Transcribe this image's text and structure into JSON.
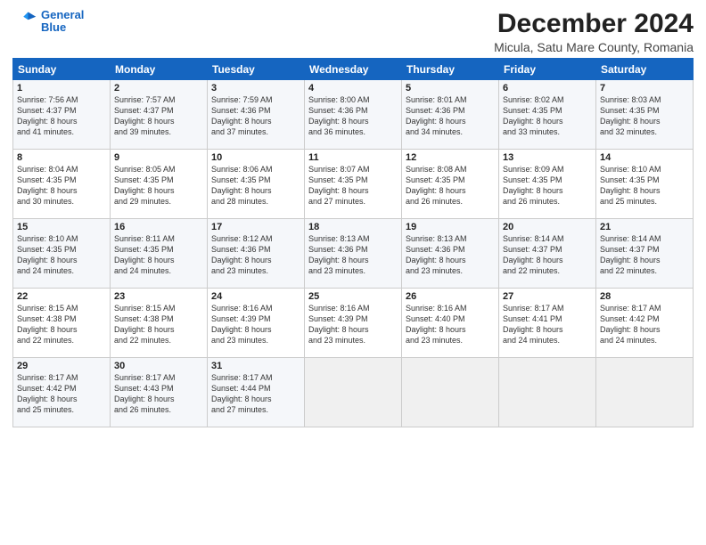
{
  "header": {
    "logo_line1": "General",
    "logo_line2": "Blue",
    "month_title": "December 2024",
    "location": "Micula, Satu Mare County, Romania"
  },
  "days_of_week": [
    "Sunday",
    "Monday",
    "Tuesday",
    "Wednesday",
    "Thursday",
    "Friday",
    "Saturday"
  ],
  "weeks": [
    [
      {
        "day": "1",
        "text": "Sunrise: 7:56 AM\nSunset: 4:37 PM\nDaylight: 8 hours\nand 41 minutes."
      },
      {
        "day": "2",
        "text": "Sunrise: 7:57 AM\nSunset: 4:37 PM\nDaylight: 8 hours\nand 39 minutes."
      },
      {
        "day": "3",
        "text": "Sunrise: 7:59 AM\nSunset: 4:36 PM\nDaylight: 8 hours\nand 37 minutes."
      },
      {
        "day": "4",
        "text": "Sunrise: 8:00 AM\nSunset: 4:36 PM\nDaylight: 8 hours\nand 36 minutes."
      },
      {
        "day": "5",
        "text": "Sunrise: 8:01 AM\nSunset: 4:36 PM\nDaylight: 8 hours\nand 34 minutes."
      },
      {
        "day": "6",
        "text": "Sunrise: 8:02 AM\nSunset: 4:35 PM\nDaylight: 8 hours\nand 33 minutes."
      },
      {
        "day": "7",
        "text": "Sunrise: 8:03 AM\nSunset: 4:35 PM\nDaylight: 8 hours\nand 32 minutes."
      }
    ],
    [
      {
        "day": "8",
        "text": "Sunrise: 8:04 AM\nSunset: 4:35 PM\nDaylight: 8 hours\nand 30 minutes."
      },
      {
        "day": "9",
        "text": "Sunrise: 8:05 AM\nSunset: 4:35 PM\nDaylight: 8 hours\nand 29 minutes."
      },
      {
        "day": "10",
        "text": "Sunrise: 8:06 AM\nSunset: 4:35 PM\nDaylight: 8 hours\nand 28 minutes."
      },
      {
        "day": "11",
        "text": "Sunrise: 8:07 AM\nSunset: 4:35 PM\nDaylight: 8 hours\nand 27 minutes."
      },
      {
        "day": "12",
        "text": "Sunrise: 8:08 AM\nSunset: 4:35 PM\nDaylight: 8 hours\nand 26 minutes."
      },
      {
        "day": "13",
        "text": "Sunrise: 8:09 AM\nSunset: 4:35 PM\nDaylight: 8 hours\nand 26 minutes."
      },
      {
        "day": "14",
        "text": "Sunrise: 8:10 AM\nSunset: 4:35 PM\nDaylight: 8 hours\nand 25 minutes."
      }
    ],
    [
      {
        "day": "15",
        "text": "Sunrise: 8:10 AM\nSunset: 4:35 PM\nDaylight: 8 hours\nand 24 minutes."
      },
      {
        "day": "16",
        "text": "Sunrise: 8:11 AM\nSunset: 4:35 PM\nDaylight: 8 hours\nand 24 minutes."
      },
      {
        "day": "17",
        "text": "Sunrise: 8:12 AM\nSunset: 4:36 PM\nDaylight: 8 hours\nand 23 minutes."
      },
      {
        "day": "18",
        "text": "Sunrise: 8:13 AM\nSunset: 4:36 PM\nDaylight: 8 hours\nand 23 minutes."
      },
      {
        "day": "19",
        "text": "Sunrise: 8:13 AM\nSunset: 4:36 PM\nDaylight: 8 hours\nand 23 minutes."
      },
      {
        "day": "20",
        "text": "Sunrise: 8:14 AM\nSunset: 4:37 PM\nDaylight: 8 hours\nand 22 minutes."
      },
      {
        "day": "21",
        "text": "Sunrise: 8:14 AM\nSunset: 4:37 PM\nDaylight: 8 hours\nand 22 minutes."
      }
    ],
    [
      {
        "day": "22",
        "text": "Sunrise: 8:15 AM\nSunset: 4:38 PM\nDaylight: 8 hours\nand 22 minutes."
      },
      {
        "day": "23",
        "text": "Sunrise: 8:15 AM\nSunset: 4:38 PM\nDaylight: 8 hours\nand 22 minutes."
      },
      {
        "day": "24",
        "text": "Sunrise: 8:16 AM\nSunset: 4:39 PM\nDaylight: 8 hours\nand 23 minutes."
      },
      {
        "day": "25",
        "text": "Sunrise: 8:16 AM\nSunset: 4:39 PM\nDaylight: 8 hours\nand 23 minutes."
      },
      {
        "day": "26",
        "text": "Sunrise: 8:16 AM\nSunset: 4:40 PM\nDaylight: 8 hours\nand 23 minutes."
      },
      {
        "day": "27",
        "text": "Sunrise: 8:17 AM\nSunset: 4:41 PM\nDaylight: 8 hours\nand 24 minutes."
      },
      {
        "day": "28",
        "text": "Sunrise: 8:17 AM\nSunset: 4:42 PM\nDaylight: 8 hours\nand 24 minutes."
      }
    ],
    [
      {
        "day": "29",
        "text": "Sunrise: 8:17 AM\nSunset: 4:42 PM\nDaylight: 8 hours\nand 25 minutes."
      },
      {
        "day": "30",
        "text": "Sunrise: 8:17 AM\nSunset: 4:43 PM\nDaylight: 8 hours\nand 26 minutes."
      },
      {
        "day": "31",
        "text": "Sunrise: 8:17 AM\nSunset: 4:44 PM\nDaylight: 8 hours\nand 27 minutes."
      },
      {
        "day": "",
        "text": ""
      },
      {
        "day": "",
        "text": ""
      },
      {
        "day": "",
        "text": ""
      },
      {
        "day": "",
        "text": ""
      }
    ]
  ]
}
